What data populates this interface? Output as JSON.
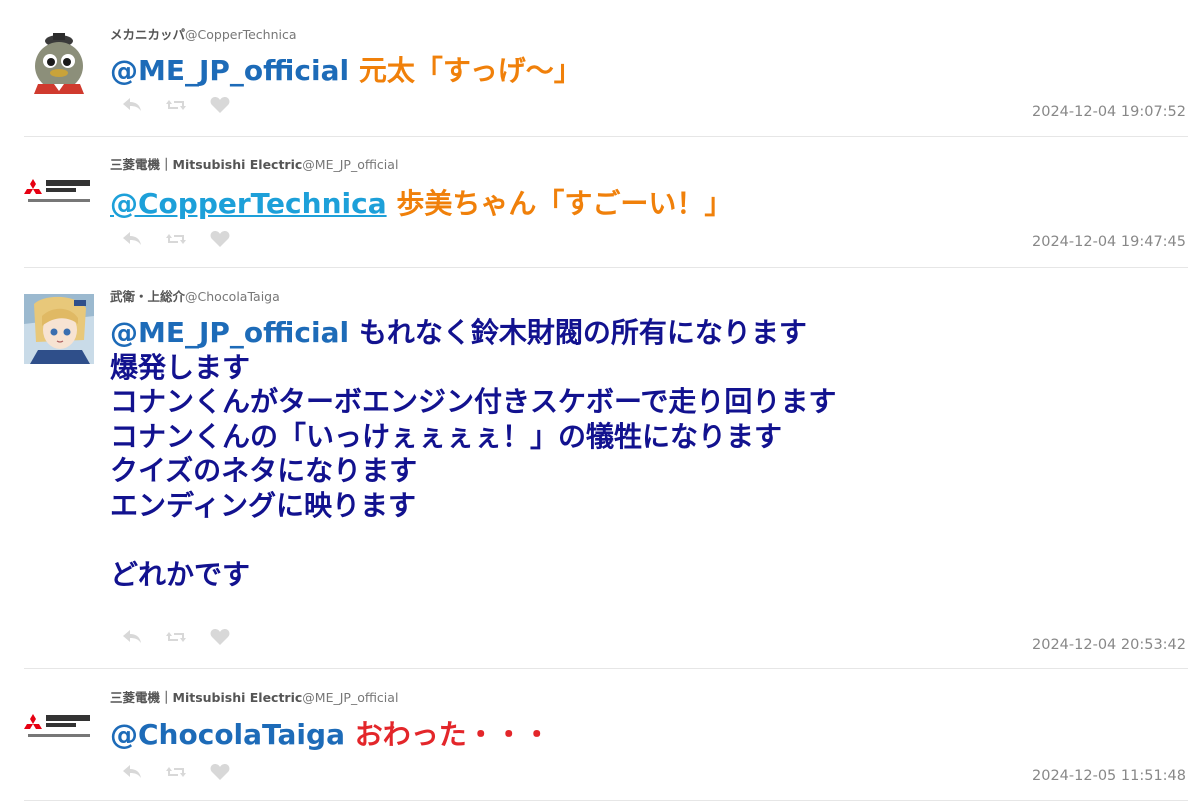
{
  "tweets": [
    {
      "display_name": "メカニカッパ",
      "screen_name": "@CopperTechnica",
      "mention": "@ME_JP_official",
      "text": " 元太「すっげ〜」",
      "timestamp": "2024-12-04 19:07:52",
      "text_color": "#f0800a"
    },
    {
      "display_name": "三菱電機｜Mitsubishi Electric",
      "screen_name": "@ME_JP_official",
      "mention": "@CopperTechnica",
      "text": " 歩美ちゃん「すごーい！」",
      "timestamp": "2024-12-04 19:47:45",
      "text_color": "#f0800a"
    },
    {
      "display_name": "武衛・上総介",
      "screen_name": "@ChocolaTaiga",
      "mention": "@ME_JP_official",
      "lines": [
        " もれなく鈴木財閥の所有になります",
        "爆発します",
        "コナンくんがターボエンジン付きスケボーで走り回ります",
        "コナンくんの「いっけぇぇぇぇ！」の犠牲になります",
        "クイズのネタになります",
        "エンディングに映ります",
        "",
        "どれかです"
      ],
      "timestamp": "2024-12-04 20:53:42",
      "text_color": "#12128f"
    },
    {
      "display_name": "三菱電機｜Mitsubishi Electric",
      "screen_name": "@ME_JP_official",
      "mention": "@ChocolaTaiga",
      "text": " おわった・・・",
      "timestamp": "2024-12-05 11:51:48",
      "text_color": "#e3262a"
    }
  ],
  "icons": {
    "reply": "reply-icon",
    "retweet": "retweet-icon",
    "like": "heart-icon"
  },
  "colors": {
    "mention": "#1d6bb8",
    "mention_linked": "#1da0d9",
    "meta": "#888888",
    "divider": "#e6e6e6"
  }
}
